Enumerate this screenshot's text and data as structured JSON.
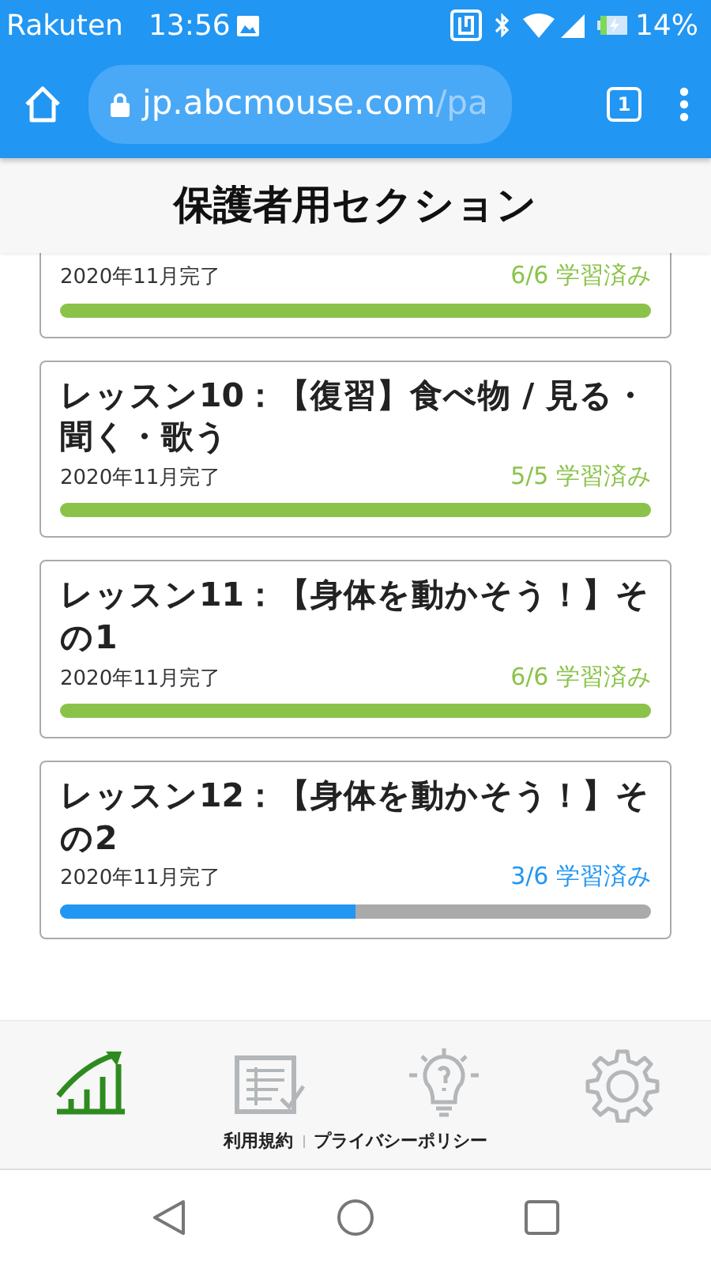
{
  "status_bar": {
    "carrier": "Rakuten",
    "time": "13:56",
    "battery": "14%"
  },
  "browser": {
    "url_host": "jp.abcmouse.com",
    "url_path": "/pa",
    "tab_count": "1"
  },
  "header": {
    "title": "保護者用セクション"
  },
  "lessons": [
    {
      "date": "2020年11月完了",
      "progress_text": "6/6 学習済み",
      "level": 1,
      "complete": true
    },
    {
      "title": "レッスン10：【復習】食べ物 / 見る・聞く・歌う",
      "date": "2020年11月完了",
      "progress_text": "5/5 学習済み",
      "level": 1,
      "complete": true
    },
    {
      "title": "レッスン11：【身体を動かそう！】その1",
      "date": "2020年11月完了",
      "progress_text": "6/6 学習済み",
      "level": 1,
      "complete": true
    },
    {
      "title": "レッスン12：【身体を動かそう！】その2",
      "date": "2020年11月完了",
      "progress_text": "3/6 学習済み",
      "level": 0.5,
      "complete": false
    }
  ],
  "bottom_tabs": [
    {
      "kind": "progress",
      "selected": true
    },
    {
      "kind": "worksheet",
      "selected": false
    },
    {
      "kind": "tips",
      "selected": false
    },
    {
      "kind": "settings",
      "selected": false
    }
  ],
  "footer_links": [
    "利用規約",
    "プライバシーポリシー"
  ]
}
